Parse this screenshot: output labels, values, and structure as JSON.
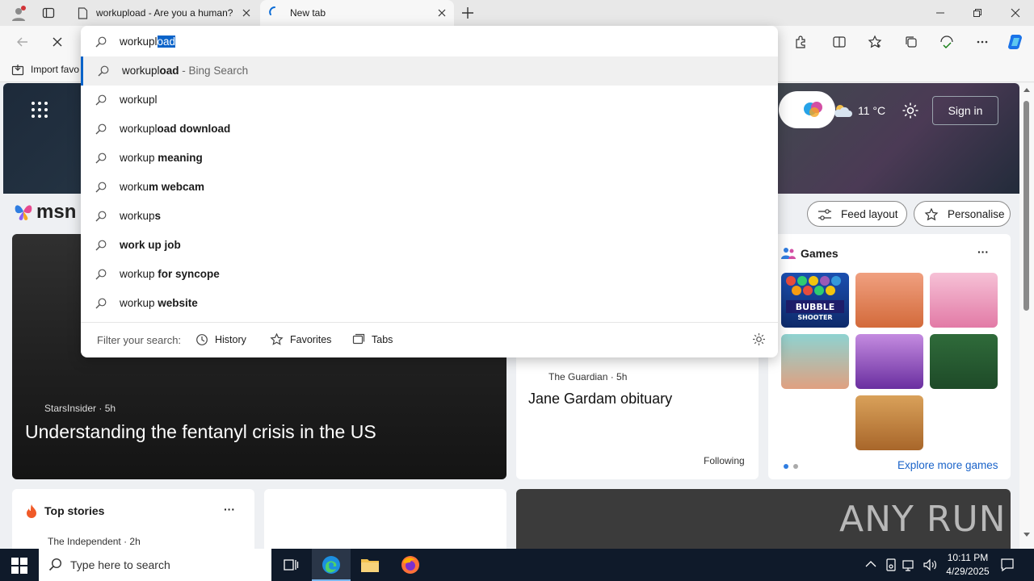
{
  "tabs": [
    {
      "title": "workupload - Are you a human?"
    },
    {
      "title": "New tab"
    }
  ],
  "addressbar": {
    "typed": "workupl",
    "autocomplete": "oad"
  },
  "favorites": {
    "import_label": "Import favo"
  },
  "suggestions": [
    {
      "prefix": "workupl",
      "bold": "oad",
      "suffix": " - Bing Search",
      "highlight": true
    },
    {
      "prefix": "workupl",
      "bold": "",
      "suffix": ""
    },
    {
      "prefix": "workupl",
      "bold": "oad download",
      "suffix": ""
    },
    {
      "prefix": "workup",
      "bold": " meaning",
      "suffix": ""
    },
    {
      "prefix": "worku",
      "bold": "m webcam",
      "suffix": ""
    },
    {
      "prefix": "workup",
      "bold": "s",
      "suffix": ""
    },
    {
      "prefix": "",
      "bold": "work up job",
      "suffix": ""
    },
    {
      "prefix": "workup",
      "bold": " for syncope",
      "suffix": ""
    },
    {
      "prefix": "workup",
      "bold": " website",
      "suffix": ""
    }
  ],
  "filter": {
    "label": "Filter your search:",
    "history": "History",
    "favorites": "Favorites",
    "tabs": "Tabs"
  },
  "msn": {
    "logo": "msn",
    "weather": "11 °C",
    "signin": "Sign in",
    "feed_layout": "Feed layout",
    "personalise": "Personalise"
  },
  "hero_story": {
    "source": "StarsInsider · 5h",
    "title": "Understanding the fentanyl crisis in the US"
  },
  "guardian_story": {
    "source": "The Guardian · 5h",
    "title": "Jane Gardam obituary",
    "following": "Following"
  },
  "games": {
    "title": "Games",
    "more": "···",
    "explore": "Explore more games"
  },
  "top_stories": {
    "title": "Top stories",
    "more": "···",
    "source": "The Independent · 2h"
  },
  "watermark": "ANY RUN",
  "taskbar": {
    "search_placeholder": "Type here to search",
    "time": "10:11 PM",
    "date": "4/29/2025"
  }
}
